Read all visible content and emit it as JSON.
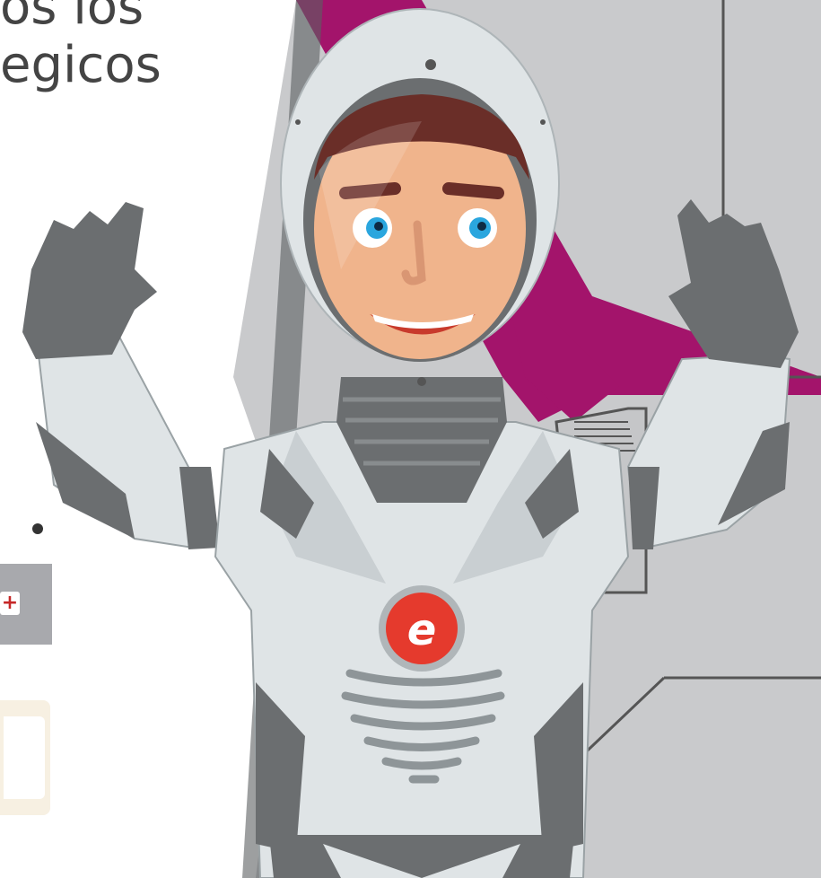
{
  "slide": {
    "heading_line_1": "os los",
    "heading_line_2": "egicos",
    "add_button_label": "+"
  },
  "colors": {
    "accent_magenta": "#a3146b",
    "panel_grey": "#c9cacc",
    "suit_light": "#dfe4e6",
    "suit_dark": "#6b6e70",
    "logo_red": "#e53a2d"
  },
  "icons": {
    "add": "plus-icon",
    "logo": "e-logo-icon"
  }
}
